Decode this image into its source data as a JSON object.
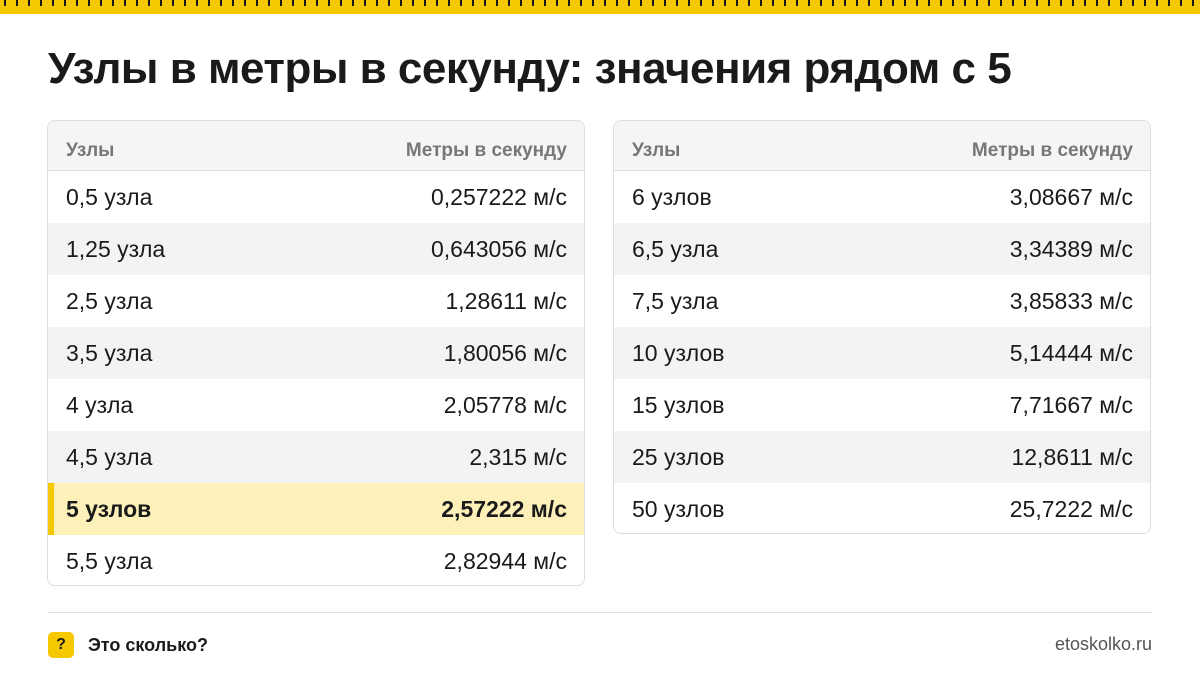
{
  "title": "Узлы в метры в секунду: значения рядом с 5",
  "colors": {
    "accent": "#f5c800",
    "highlight": "#fdf0b8"
  },
  "left_table": {
    "headers": [
      "Узлы",
      "Метры в секунду"
    ],
    "rows": [
      {
        "knots": "0,5 узла",
        "ms": "0,257222 м/с"
      },
      {
        "knots": "1,25 узла",
        "ms": "0,643056 м/с"
      },
      {
        "knots": "2,5 узла",
        "ms": "1,28611 м/с"
      },
      {
        "knots": "3,5 узла",
        "ms": "1,80056 м/с"
      },
      {
        "knots": "4 узла",
        "ms": "2,05778 м/с"
      },
      {
        "knots": "4,5 узла",
        "ms": "2,315 м/с"
      },
      {
        "knots": "5 узлов",
        "ms": "2,57222 м/с"
      },
      {
        "knots": "5,5 узла",
        "ms": "2,82944 м/с"
      }
    ]
  },
  "right_table": {
    "headers": [
      "Узлы",
      "Метры в секунду"
    ],
    "rows": [
      {
        "knots": "6 узлов",
        "ms": "3,08667 м/с"
      },
      {
        "knots": "6,5 узла",
        "ms": "3,34389 м/с"
      },
      {
        "knots": "7,5 узла",
        "ms": "3,85833 м/с"
      },
      {
        "knots": "10 узлов",
        "ms": "5,14444 м/с"
      },
      {
        "knots": "15 узлов",
        "ms": "7,71667 м/с"
      },
      {
        "knots": "25 узлов",
        "ms": "12,8611 м/с"
      },
      {
        "knots": "50 узлов",
        "ms": "25,7222 м/с"
      }
    ]
  },
  "footer": {
    "badge": "?",
    "brand": "Это сколько?",
    "site": "etoskolko.ru"
  }
}
